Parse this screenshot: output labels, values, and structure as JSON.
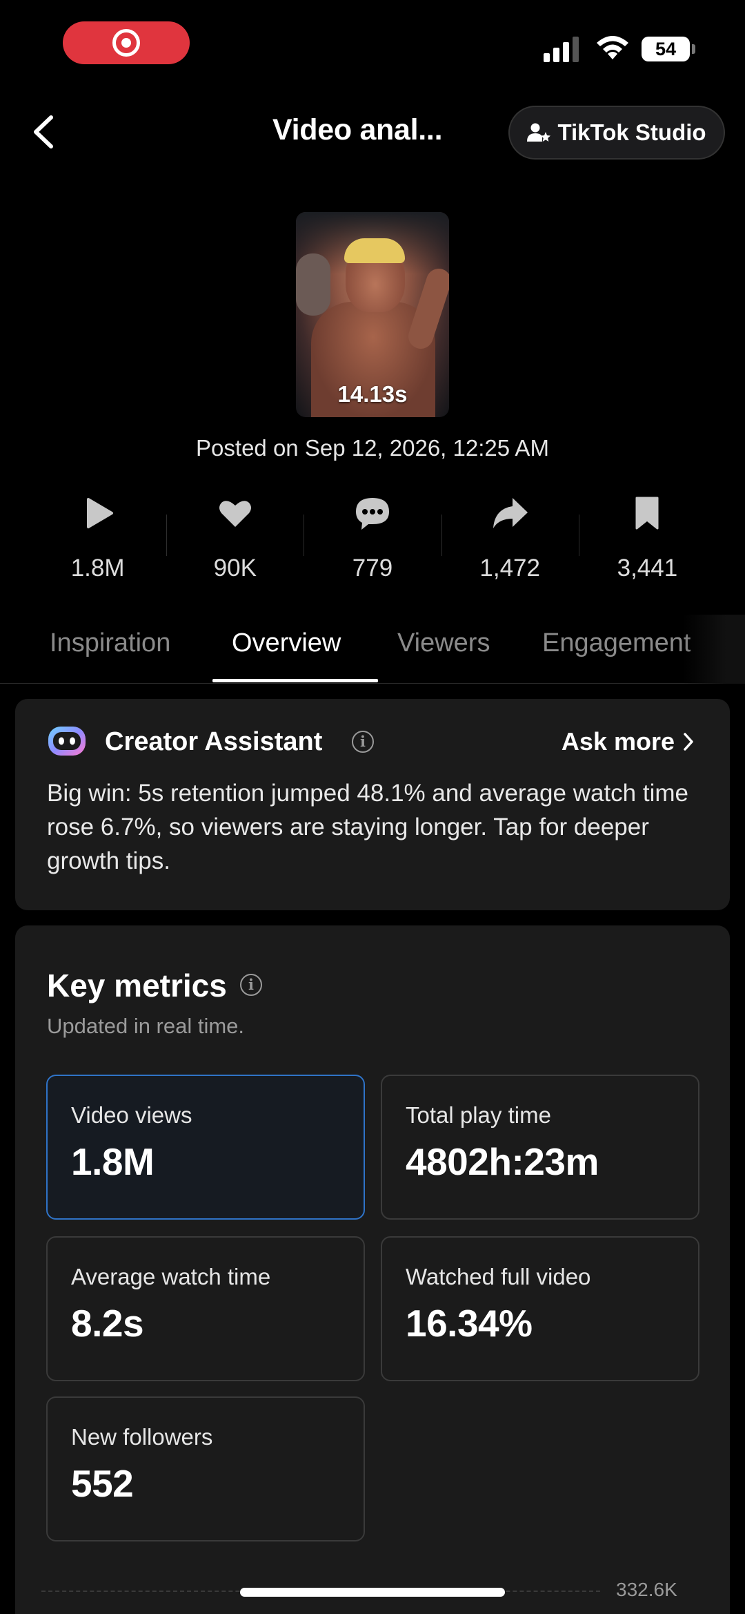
{
  "status_bar": {
    "battery": "54"
  },
  "header": {
    "title": "Video anal...",
    "studio_button": "TikTok Studio"
  },
  "video": {
    "duration": "14.13s",
    "posted": "Posted on Sep 12, 2026, 12:25 AM"
  },
  "stats": [
    {
      "icon": "play-icon",
      "value": "1.8M"
    },
    {
      "icon": "heart-icon",
      "value": "90K"
    },
    {
      "icon": "comment-icon",
      "value": "779"
    },
    {
      "icon": "share-icon",
      "value": "1,472"
    },
    {
      "icon": "bookmark-icon",
      "value": "3,441"
    }
  ],
  "tabs": [
    "Inspiration",
    "Overview",
    "Viewers",
    "Engagement"
  ],
  "active_tab": "Overview",
  "assistant": {
    "title": "Creator Assistant",
    "ask_more": "Ask more",
    "text": "Big win: 5s retention jumped 48.1% and average watch time rose 6.7%, so viewers are staying longer. Tap for deeper growth tips."
  },
  "key_metrics": {
    "title": "Key metrics",
    "subtitle": "Updated in real time.",
    "items": [
      {
        "label": "Video views",
        "value": "1.8M"
      },
      {
        "label": "Total play time",
        "value": "4802h:23m"
      },
      {
        "label": "Average watch time",
        "value": "8.2s"
      },
      {
        "label": "Watched full video",
        "value": "16.34%"
      },
      {
        "label": "New followers",
        "value": "552"
      }
    ],
    "selected": "Video views"
  },
  "chart_axis_label": "332.6K",
  "colors": {
    "selected_border": "#2f73c7",
    "record_pill": "#e0353e",
    "card_bg": "#1b1b1b"
  }
}
